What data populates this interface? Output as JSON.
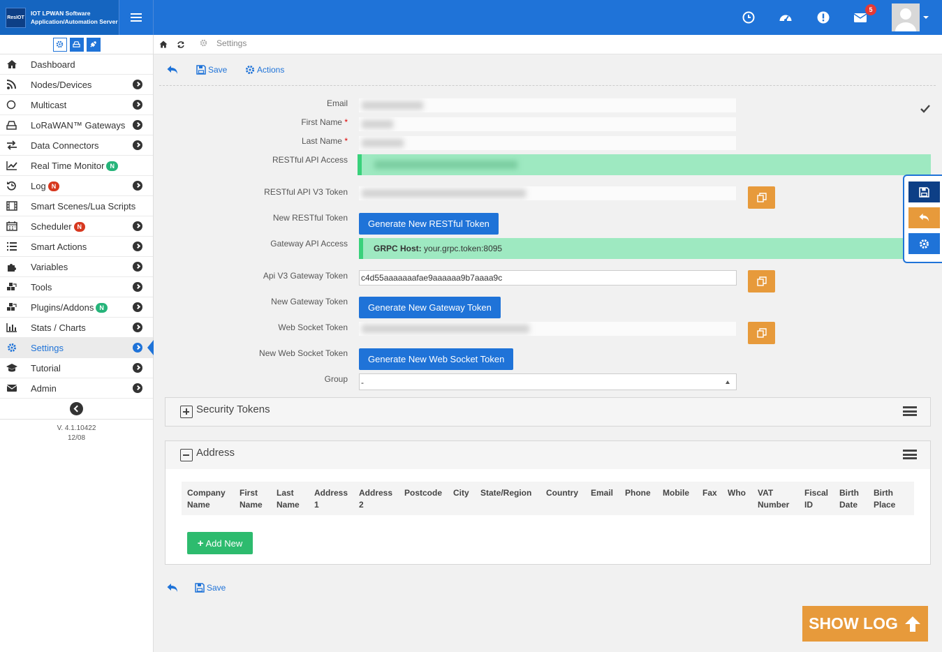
{
  "app": {
    "logo_text": "ResIOT",
    "brand_line1": "IOT LPWAN Software",
    "brand_line2": "Application/Automation Server",
    "notification_count": "5"
  },
  "sidebar": {
    "items": [
      {
        "label": "Dashboard",
        "icon": "home-icon",
        "has_arrow": false
      },
      {
        "label": "Nodes/Devices",
        "icon": "rss-icon",
        "has_arrow": true
      },
      {
        "label": "Multicast",
        "icon": "circle-icon",
        "has_arrow": true
      },
      {
        "label": "LoRaWAN™ Gateways",
        "icon": "hdd-icon",
        "has_arrow": true
      },
      {
        "label": "Data Connectors",
        "icon": "exchange-icon",
        "has_arrow": true
      },
      {
        "label": "Real Time Monitor",
        "icon": "line-chart-icon",
        "tag": "N",
        "tag_color": "green",
        "has_arrow": false
      },
      {
        "label": "Log",
        "icon": "history-icon",
        "tag": "N",
        "tag_color": "red",
        "has_arrow": true
      },
      {
        "label": "Smart Scenes/Lua Scripts",
        "icon": "film-icon",
        "has_arrow": false
      },
      {
        "label": "Scheduler",
        "icon": "calendar-icon",
        "tag": "N",
        "tag_color": "red",
        "has_arrow": true
      },
      {
        "label": "Smart Actions",
        "icon": "list-icon",
        "has_arrow": true
      },
      {
        "label": "Variables",
        "icon": "puzzle-icon",
        "has_arrow": true
      },
      {
        "label": "Tools",
        "icon": "cubes-icon",
        "has_arrow": true
      },
      {
        "label": "Plugins/Addons",
        "icon": "cubes-icon",
        "tag": "N",
        "tag_color": "green",
        "has_arrow": true
      },
      {
        "label": "Stats / Charts",
        "icon": "bar-chart-icon",
        "has_arrow": true
      },
      {
        "label": "Settings",
        "icon": "gear-icon",
        "has_arrow": true,
        "active": true
      },
      {
        "label": "Tutorial",
        "icon": "graduation-cap-icon",
        "has_arrow": true
      },
      {
        "label": "Admin",
        "icon": "envelope-icon",
        "has_arrow": true
      }
    ],
    "version_line1": "V. 4.1.10422",
    "version_line2": "12/08"
  },
  "breadcrumb": {
    "current": "Settings"
  },
  "toolbar": {
    "save_label": "Save",
    "actions_label": "Actions"
  },
  "form": {
    "email_label": "Email",
    "first_name_label": "First Name",
    "last_name_label": "Last Name",
    "required_mark": "*",
    "restful_access_label": "RESTful API Access",
    "restful_v3_label": "RESTful API V3 Token",
    "new_restful_label": "New RESTful Token",
    "new_restful_button": "Generate New RESTful Token",
    "gateway_access_label": "Gateway API Access",
    "grpc_host_label": "GRPC Host:",
    "grpc_host_value": "your.grpc.token:8095",
    "api_v3_gateway_label": "Api V3 Gateway Token",
    "api_v3_gateway_value": "c4d55aaaaaaafae9aaaaaa9b7aaaa9c",
    "new_gateway_label": "New Gateway Token",
    "new_gateway_button": "Generate New Gateway Token",
    "websocket_label": "Web Socket Token",
    "new_websocket_label": "New Web Socket Token",
    "new_websocket_button": "Generate New Web Socket Token",
    "group_label": "Group",
    "group_value": "-"
  },
  "panels": {
    "security_title": "Security Tokens",
    "address_title": "Address"
  },
  "address_table": {
    "columns": [
      [
        "Company",
        "Name"
      ],
      [
        "First",
        "Name"
      ],
      [
        "Last",
        "Name"
      ],
      [
        "Address",
        "1"
      ],
      [
        "Address",
        "2"
      ],
      [
        "Postcode",
        ""
      ],
      [
        "City",
        ""
      ],
      [
        "State/Region",
        ""
      ],
      [
        "Country",
        ""
      ],
      [
        "Email",
        ""
      ],
      [
        "Phone",
        ""
      ],
      [
        "Mobile",
        ""
      ],
      [
        "Fax",
        ""
      ],
      [
        "Who",
        ""
      ],
      [
        "VAT",
        "Number"
      ],
      [
        "Fiscal",
        "ID"
      ],
      [
        "Birth",
        "Date"
      ],
      [
        "Birth",
        "Place"
      ]
    ],
    "add_new_label": "Add New"
  },
  "footer": {
    "save_label": "Save",
    "show_log_label": "SHOW LOG"
  },
  "colors": {
    "primary": "#1f73d8",
    "orange": "#e79a3b",
    "green": "#2dbb6e",
    "mint": "#9ee9c1"
  }
}
